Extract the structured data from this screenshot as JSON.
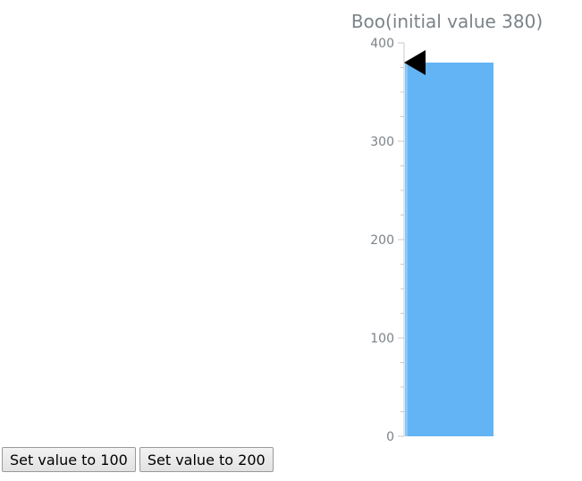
{
  "gauge": {
    "title": "Boo(initial value 380)"
  },
  "controls": {
    "set_100_label": "Set value to 100",
    "set_200_label": "Set value to 200"
  },
  "chart_data": {
    "type": "bar",
    "title": "Boo(initial value 380)",
    "categories": [
      ""
    ],
    "values": [
      380
    ],
    "ylim": [
      0,
      400
    ],
    "yticks": [
      0,
      100,
      200,
      300,
      400
    ],
    "pointer_value": 380,
    "bar_color": "#63b4f5",
    "pointer_color": "#000000",
    "axis_color": "#c8c8c8",
    "tick_label_color": "#7b8388"
  }
}
